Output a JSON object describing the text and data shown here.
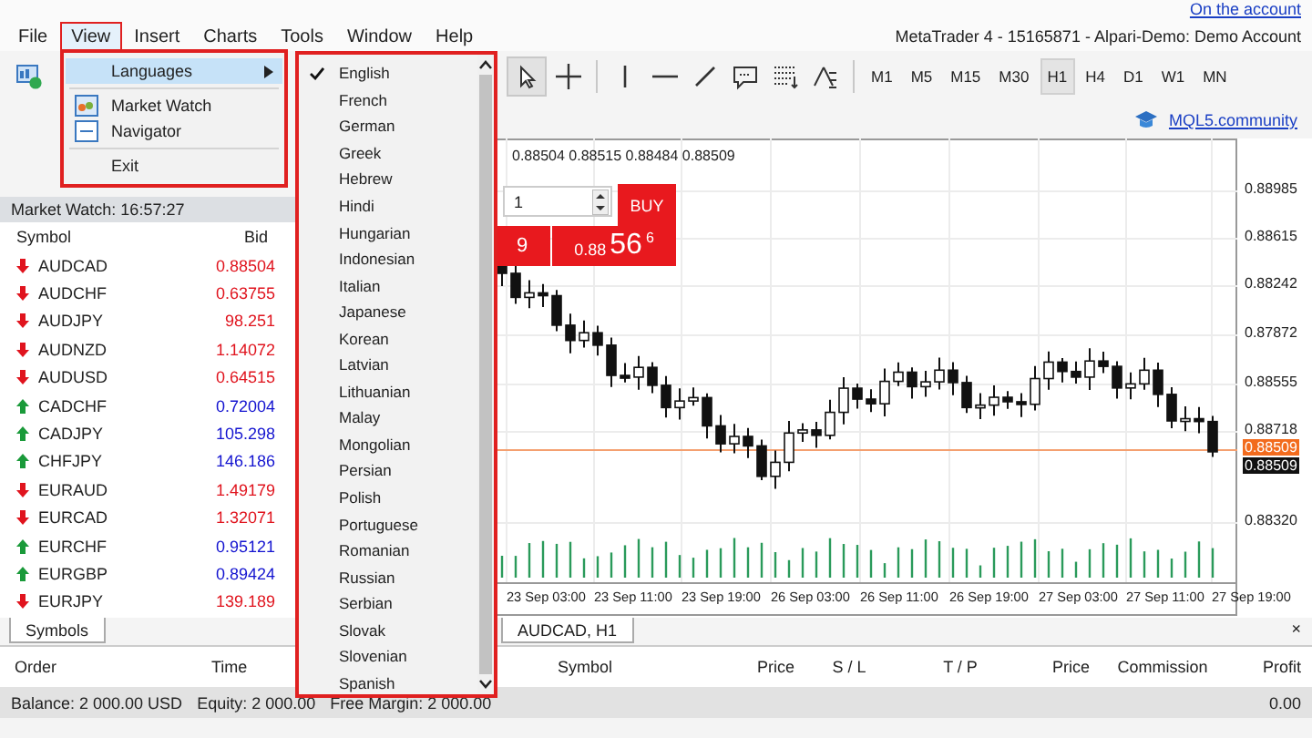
{
  "top_link": "On the account",
  "menu": [
    {
      "label": "File",
      "selected": false
    },
    {
      "label": "View",
      "selected": true
    },
    {
      "label": "Insert",
      "selected": false
    },
    {
      "label": "Charts",
      "selected": false
    },
    {
      "label": "Tools",
      "selected": false
    },
    {
      "label": "Window",
      "selected": false
    },
    {
      "label": "Help",
      "selected": false
    }
  ],
  "title": "MetaTrader 4 - 15165871 - Alpari-Demo: Demo Account",
  "periods": [
    {
      "label": "M1",
      "selected": false
    },
    {
      "label": "M5",
      "selected": false
    },
    {
      "label": "M15",
      "selected": false
    },
    {
      "label": "M30",
      "selected": false
    },
    {
      "label": "H1",
      "selected": true
    },
    {
      "label": "H4",
      "selected": false
    },
    {
      "label": "D1",
      "selected": false
    },
    {
      "label": "W1",
      "selected": false
    },
    {
      "label": "MN",
      "selected": false
    }
  ],
  "community_link": "MQL5.community",
  "view_menu": [
    {
      "kind": "submenu",
      "label": "Languages",
      "highlighted": true
    },
    {
      "kind": "separator"
    },
    {
      "kind": "icon-item",
      "label": "Market Watch",
      "highlighted": false
    },
    {
      "kind": "icon-item",
      "label": "Navigator",
      "highlighted": false
    },
    {
      "kind": "separator"
    },
    {
      "kind": "item",
      "label": "Exit",
      "highlighted": false
    }
  ],
  "languages": [
    {
      "label": "English",
      "checked": true
    },
    {
      "label": "French",
      "checked": false
    },
    {
      "label": "German",
      "checked": false
    },
    {
      "label": "Greek",
      "checked": false
    },
    {
      "label": "Hebrew",
      "checked": false
    },
    {
      "label": "Hindi",
      "checked": false
    },
    {
      "label": "Hungarian",
      "checked": false
    },
    {
      "label": "Indonesian",
      "checked": false
    },
    {
      "label": "Italian",
      "checked": false
    },
    {
      "label": "Japanese",
      "checked": false
    },
    {
      "label": "Korean",
      "checked": false
    },
    {
      "label": "Latvian",
      "checked": false
    },
    {
      "label": "Lithuanian",
      "checked": false
    },
    {
      "label": "Malay",
      "checked": false
    },
    {
      "label": "Mongolian",
      "checked": false
    },
    {
      "label": "Persian",
      "checked": false
    },
    {
      "label": "Polish",
      "checked": false
    },
    {
      "label": "Portuguese",
      "checked": false
    },
    {
      "label": "Romanian",
      "checked": false
    },
    {
      "label": "Russian",
      "checked": false
    },
    {
      "label": "Serbian",
      "checked": false
    },
    {
      "label": "Slovak",
      "checked": false
    },
    {
      "label": "Slovenian",
      "checked": false
    },
    {
      "label": "Spanish",
      "checked": false
    }
  ],
  "market_watch": {
    "title": "Market Watch: 16:57:27",
    "columns": [
      "Symbol",
      "Bid"
    ],
    "rows": [
      {
        "symbol": "AUDCAD",
        "bid": "0.88504",
        "rising": false
      },
      {
        "symbol": "AUDCHF",
        "bid": "0.63755",
        "rising": false
      },
      {
        "symbol": "AUDJPY",
        "bid": "98.251",
        "rising": false
      },
      {
        "symbol": "AUDNZD",
        "bid": "1.14072",
        "rising": false
      },
      {
        "symbol": "AUDUSD",
        "bid": "0.64515",
        "rising": false
      },
      {
        "symbol": "CADCHF",
        "bid": "0.72004",
        "rising": true
      },
      {
        "symbol": "CADJPY",
        "bid": "105.298",
        "rising": true
      },
      {
        "symbol": "CHFJPY",
        "bid": "146.186",
        "rising": true
      },
      {
        "symbol": "EURAUD",
        "bid": "1.49179",
        "rising": false
      },
      {
        "symbol": "EURCAD",
        "bid": "1.32071",
        "rising": false
      },
      {
        "symbol": "EURCHF",
        "bid": "0.95121",
        "rising": true
      },
      {
        "symbol": "EURGBP",
        "bid": "0.89424",
        "rising": true
      },
      {
        "symbol": "EURJPY",
        "bid": "139.189",
        "rising": false
      }
    ],
    "tab": "Symbols"
  },
  "chart": {
    "quote": "0.88504 0.88515 0.88484 0.88509",
    "lot": "1",
    "buy_label": "BUY",
    "sell_price_fragment": "9",
    "buy_price": {
      "prefix": "0.88",
      "big": "56",
      "pip": "6"
    },
    "price_axis": [
      "0.88985",
      "0.88615",
      "0.88242",
      "0.87872",
      "0.88555",
      "0.88718",
      "0.88320"
    ],
    "current_price": [
      "0.88509",
      "0.88509"
    ],
    "time_axis": [
      "23 Sep 03:00",
      "23 Sep 11:00",
      "23 Sep 19:00",
      "26 Sep 03:00",
      "26 Sep 11:00",
      "26 Sep 19:00",
      "27 Sep 03:00",
      "27 Sep 11:00",
      "27 Sep 19:00"
    ],
    "tab": "AUDCAD, H1",
    "close": "×"
  },
  "terminal": {
    "columns": [
      "Order",
      "Time",
      "Symbol",
      "Price",
      "S / L",
      "T / P",
      "Price",
      "Commission",
      "Profit"
    ],
    "balance": "Balance: 2 000.00 USD",
    "equity": "Equity: 2 000.00",
    "free_margin": "Free Margin: 2 000.00",
    "profit": "0.00"
  }
}
